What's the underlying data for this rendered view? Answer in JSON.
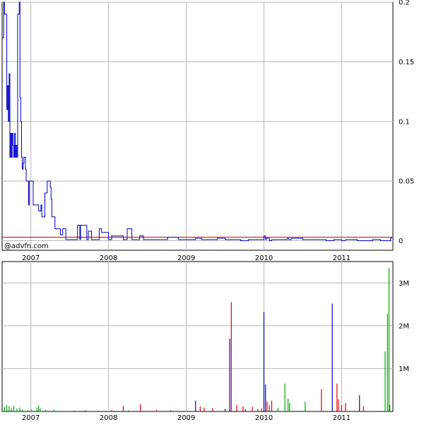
{
  "watermark": "@advfn.com",
  "colors": {
    "price_line": "#0000cc",
    "reference_line": "#cc0000",
    "volume_up": "#00aa00",
    "volume_down": "#dd0000",
    "volume_neutral": "#0000cc",
    "grid": "#b8b8b8",
    "frame": "#000000"
  },
  "chart_data": [
    {
      "type": "line",
      "title": "",
      "xlabel": "",
      "ylabel": "",
      "x_tick_labels": [
        "2007",
        "2008",
        "2009",
        "2010",
        "2011"
      ],
      "y_tick_labels": [
        "0.2",
        "0.15",
        "0.1",
        "0.05",
        "0"
      ],
      "y_ticks": [
        0.2,
        0.15,
        0.1,
        0.05,
        0
      ],
      "xlim": [
        2006.63,
        2011.66
      ],
      "ylim": [
        -0.008,
        0.2
      ],
      "grid": true,
      "reference_line": 0.003,
      "series": [
        {
          "x": [
            2006.63,
            2006.65,
            2006.66,
            2006.69,
            2006.7,
            2006.71,
            2006.72,
            2006.73,
            2006.74,
            2006.75,
            2006.76,
            2006.77,
            2006.78,
            2006.79,
            2006.8,
            2006.81,
            2006.82,
            2006.83,
            2006.85,
            2006.86,
            2006.87,
            2006.88,
            2006.89,
            2006.9,
            2006.91,
            2006.93,
            2006.94,
            2006.97,
            2006.98,
            2007.03,
            2007.08,
            2007.1,
            2007.13,
            2007.14,
            2007.18,
            2007.21,
            2007.25,
            2007.26,
            2007.27,
            2007.28,
            2007.31,
            2007.36,
            2007.38,
            2007.41,
            2007.45,
            2007.54,
            2007.59,
            2007.6,
            2007.63,
            2007.64,
            2007.72,
            2007.74,
            2007.78,
            2007.82,
            2007.87,
            2007.88,
            2007.91,
            2008.0,
            2008.03,
            2008.04,
            2008.19,
            2008.2,
            2008.23,
            2008.24,
            2008.3,
            2008.39,
            2008.4,
            2008.45,
            2008.7,
            2008.75,
            2008.76,
            2008.9,
            2009.1,
            2009.12,
            2009.2,
            2009.4,
            2009.5,
            2009.6,
            2009.7,
            2009.8,
            2009.9,
            2010.0,
            2010.02,
            2010.03,
            2010.07,
            2010.1,
            2010.2,
            2010.3,
            2010.32,
            2010.35,
            2010.5,
            2010.7,
            2010.8,
            2010.9,
            2011.0,
            2011.05,
            2011.2,
            2011.3,
            2011.4,
            2011.5,
            2011.6,
            2011.62,
            2011.63,
            2011.64
          ],
          "values": [
            0.17,
            0.2,
            0.19,
            0.11,
            0.13,
            0.1,
            0.14,
            0.07,
            0.09,
            0.07,
            0.09,
            0.08,
            0.07,
            0.09,
            0.07,
            0.08,
            0.07,
            0.19,
            0.2,
            0.12,
            0.1,
            0.07,
            0.06,
            0.065,
            0.07,
            0.06,
            0.05,
            0.03,
            0.05,
            0.03,
            0.03,
            0.025,
            0.03,
            0.02,
            0.04,
            0.05,
            0.045,
            0.035,
            0.02,
            0.02,
            0.01,
            0.01,
            0.005,
            0.01,
            0.001,
            0.001,
            0.001,
            0.013,
            0.001,
            0.013,
            0.001,
            0.008,
            0.001,
            0.001,
            0.001,
            0.01,
            0.007,
            0.001,
            0.001,
            0.004,
            0.001,
            0.001,
            0.001,
            0.01,
            0.001,
            0.001,
            0.004,
            0.001,
            0.001,
            0.001,
            0.003,
            0.001,
            0.001,
            0.002,
            0.001,
            0.002,
            0.001,
            0.001,
            0.0,
            0.001,
            0.001,
            0.004,
            0.001,
            0.002,
            0.0,
            0.001,
            0.001,
            0.002,
            0.001,
            0.002,
            0.001,
            0.001,
            0.0,
            0.001,
            0.0,
            0.001,
            0.0,
            0.0,
            0.001,
            0.0,
            0.0,
            0.0,
            0.002,
            0.003
          ]
        }
      ]
    },
    {
      "type": "bar",
      "title": "",
      "xlabel": "",
      "ylabel": "",
      "x_tick_labels": [
        "2007",
        "2008",
        "2009",
        "2010",
        "2011"
      ],
      "y_tick_labels": [
        "3M",
        "2M",
        "1M"
      ],
      "y_ticks": [
        3000000,
        2000000,
        1000000
      ],
      "xlim": [
        2006.63,
        2011.66
      ],
      "ylim": [
        0,
        3500000
      ],
      "grid": true,
      "series": [
        {
          "name": "",
          "x": [
            2006.66,
            2006.69,
            2006.72,
            2006.75,
            2006.78,
            2006.82,
            2006.86,
            2006.89,
            2006.96,
            2007.01,
            2007.08,
            2007.1,
            2007.12,
            2007.19,
            2007.3,
            2007.56,
            2007.7,
            2007.87,
            2008.04,
            2008.19,
            2008.26,
            2008.41,
            2008.62,
            2008.8,
            2009.12,
            2009.18,
            2009.23,
            2009.34,
            2009.5,
            2009.56,
            2009.58,
            2009.65,
            2009.73,
            2009.76,
            2009.85,
            2009.92,
            2009.97,
            2010.0,
            2010.02,
            2010.04,
            2010.07,
            2010.1,
            2010.18,
            2010.27,
            2010.31,
            2010.33,
            2010.53,
            2010.74,
            2010.88,
            2010.94,
            2010.96,
            2011.0,
            2011.05,
            2011.23,
            2011.28,
            2011.56,
            2011.59,
            2011.61,
            2011.62
          ],
          "values": [
            100000,
            150000,
            120000,
            80000,
            130000,
            60000,
            90000,
            40000,
            30000,
            50000,
            90000,
            140000,
            70000,
            40000,
            40000,
            20000,
            30000,
            15000,
            30000,
            130000,
            25000,
            170000,
            40000,
            30000,
            250000,
            120000,
            90000,
            80000,
            60000,
            1700000,
            2550000,
            150000,
            120000,
            60000,
            110000,
            60000,
            70000,
            2320000,
            630000,
            230000,
            140000,
            250000,
            80000,
            650000,
            300000,
            200000,
            230000,
            520000,
            2520000,
            650000,
            280000,
            150000,
            200000,
            380000,
            120000,
            1400000,
            2280000,
            3350000,
            150000
          ],
          "colors": [
            "up",
            "up",
            "up",
            "up",
            "up",
            "up",
            "up",
            "up",
            "up",
            "up",
            "up",
            "up",
            "up",
            "up",
            "up",
            "down",
            "down",
            "down",
            "down",
            "down",
            "down",
            "down",
            "down",
            "down",
            "neutral",
            "down",
            "down",
            "down",
            "neutral",
            "neutral",
            "down",
            "down",
            "down",
            "down",
            "down",
            "down",
            "down",
            "neutral",
            "neutral",
            "down",
            "down",
            "down",
            "up",
            "up",
            "up",
            "up",
            "up",
            "down",
            "neutral",
            "down",
            "down",
            "down",
            "down",
            "neutral",
            "down",
            "up",
            "up",
            "up",
            "up"
          ]
        }
      ]
    }
  ]
}
